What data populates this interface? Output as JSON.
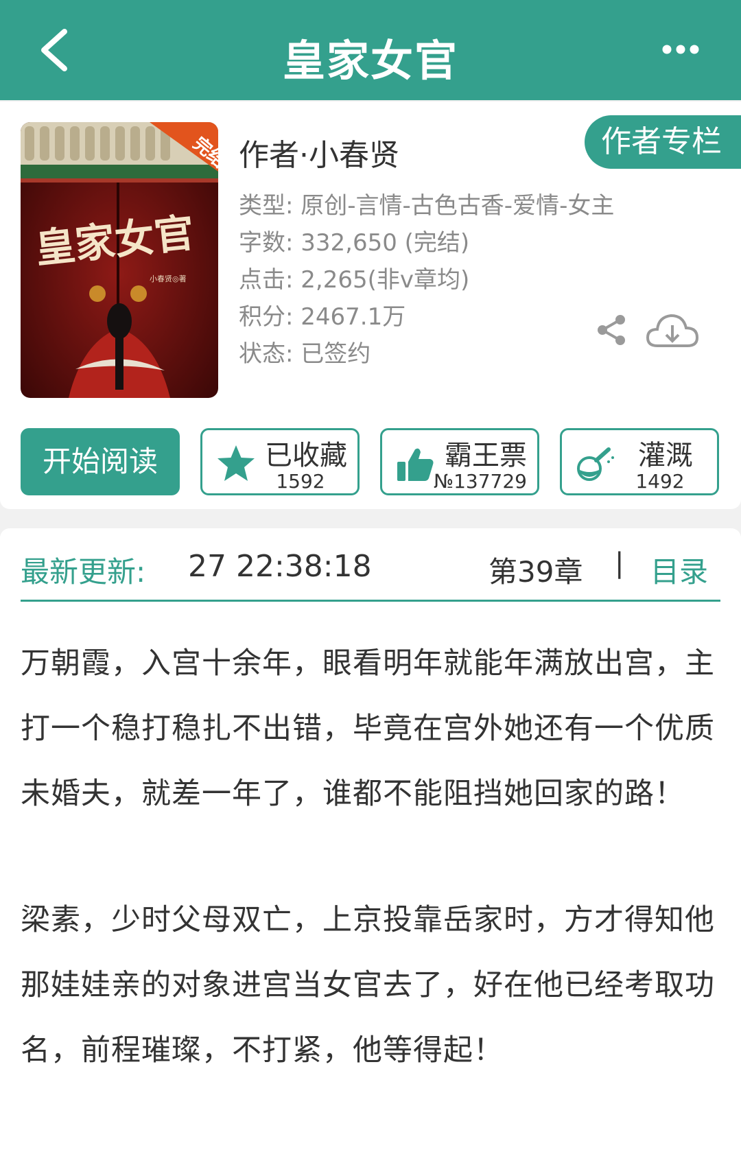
{
  "header": {
    "title": "皇家女官",
    "back_icon": "chevron-left-icon",
    "more_icon": "more-dots-icon"
  },
  "book": {
    "cover": {
      "badge": "完结",
      "title_art": "皇家女官",
      "author_small": "小春贤◎著"
    },
    "author": "作者·小春贤",
    "author_column": "作者专栏",
    "genre": "类型: 原创-言情-古色古香-爱情-女主",
    "word_count": "字数: 332,650 (完结)",
    "clicks": "点击: 2,265(非v章均)",
    "score": "积分: 2467.1万",
    "status": "状态: 已签约"
  },
  "actions": {
    "read": "开始阅读",
    "favorite": {
      "label": "已收藏",
      "count": "1592",
      "icon": "star-icon"
    },
    "ticket": {
      "label": "霸王票",
      "count": "№137729",
      "icon": "thumbs-up-icon"
    },
    "water": {
      "label": "灌溉",
      "count": "1492",
      "icon": "watering-flask-icon"
    }
  },
  "update": {
    "label": "最新更新:",
    "time": "27 22:38:18",
    "chapter": "第39章",
    "separator": "|",
    "toc": "目录"
  },
  "synopsis": [
    "万朝霞，入宫十余年，眼看明年就能年满放出宫，主打一个稳打稳扎不出错，毕竟在宫外她还有一个优质未婚夫，就差一年了，谁都不能阻挡她回家的路！",
    "梁素，少时父母双亡，上京投靠岳家时，方才得知他那娃娃亲的对象进宫当女官去了，好在他已经考取功名，前程璀璨，不打紧，他等得起！"
  ],
  "colors": {
    "accent": "#34a08d",
    "text": "#333333",
    "muted": "#8a8a8a"
  }
}
